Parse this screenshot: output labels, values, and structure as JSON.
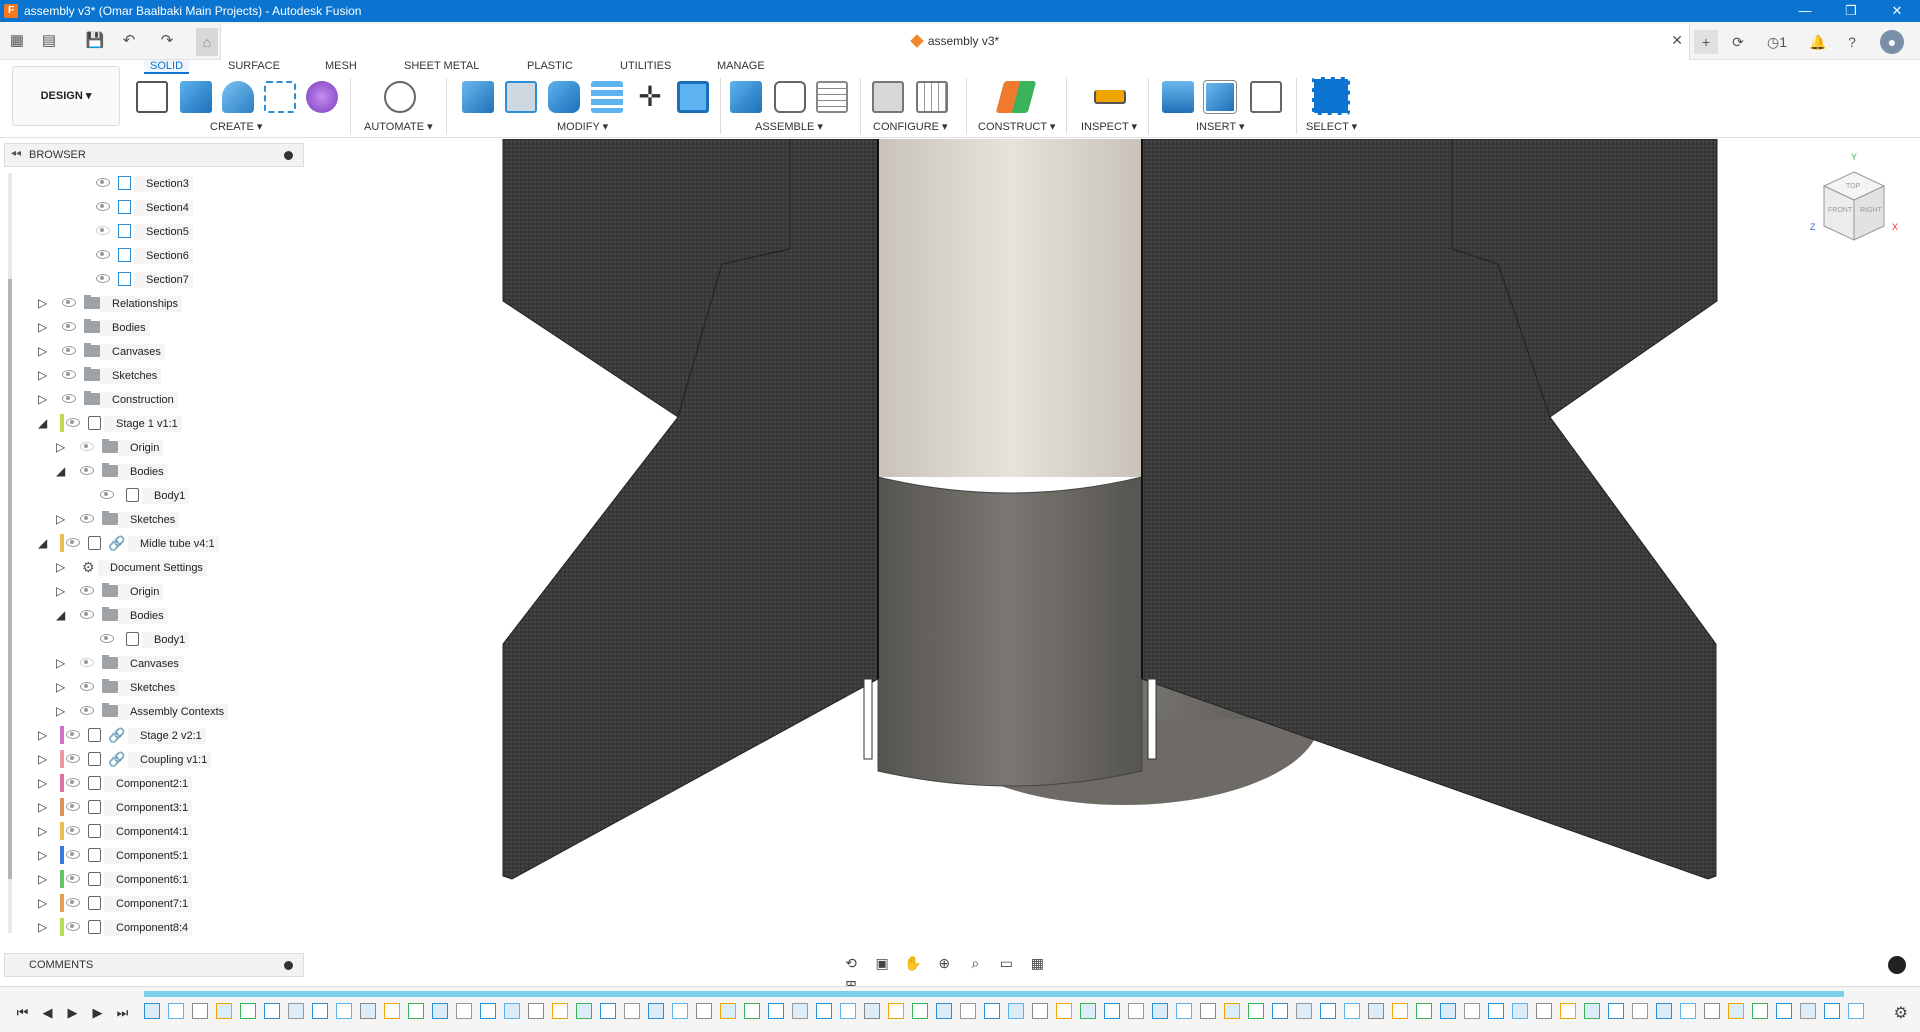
{
  "window": {
    "title": "assembly v3* (Omar Baalbaki Main Projects) - Autodesk Fusion",
    "controls": [
      "—",
      "❐",
      "✕"
    ]
  },
  "document": {
    "tab_title": "assembly v3*",
    "notification_count": "1"
  },
  "ribbon": {
    "workspace_label": "DESIGN ▾",
    "tabs": [
      "SOLID",
      "SURFACE",
      "MESH",
      "SHEET METAL",
      "PLASTIC",
      "UTILITIES",
      "MANAGE"
    ],
    "active_tab": "SOLID",
    "groups": {
      "create": "CREATE ▾",
      "automate": "AUTOMATE ▾",
      "modify": "MODIFY ▾",
      "assemble": "ASSEMBLE ▾",
      "configure": "CONFIGURE ▾",
      "construct": "CONSTRUCT ▾",
      "inspect": "INSPECT ▾",
      "insert": "INSERT ▾",
      "select": "SELECT ▾"
    }
  },
  "browser": {
    "title": "BROWSER",
    "items": [
      {
        "label": "Section3",
        "type": "sketch",
        "expander": ""
      },
      {
        "label": "Section4",
        "type": "sketch",
        "expander": ""
      },
      {
        "label": "Section5",
        "type": "sketch",
        "expander": ""
      },
      {
        "label": "Section6",
        "type": "sketch",
        "expander": ""
      },
      {
        "label": "Section7",
        "type": "sketch",
        "expander": ""
      },
      {
        "label": "Relationships",
        "type": "folder",
        "expander": "▷"
      },
      {
        "label": "Bodies",
        "type": "folder",
        "expander": "▷"
      },
      {
        "label": "Canvases",
        "type": "folder",
        "expander": "▷"
      },
      {
        "label": "Sketches",
        "type": "folder",
        "expander": "▷"
      },
      {
        "label": "Construction",
        "type": "folder",
        "expander": "▷"
      },
      {
        "label": "Stage 1 v1:1",
        "type": "component",
        "expander": "◢"
      },
      {
        "label": "Origin",
        "type": "folder",
        "expander": "▷"
      },
      {
        "label": "Bodies",
        "type": "folder",
        "expander": "◢"
      },
      {
        "label": "Body1",
        "type": "body",
        "expander": ""
      },
      {
        "label": "Sketches",
        "type": "folder",
        "expander": "▷"
      },
      {
        "label": "Midle tube v4:1",
        "type": "linked",
        "expander": "◢"
      },
      {
        "label": "Document Settings",
        "type": "settings",
        "expander": "▷"
      },
      {
        "label": "Origin",
        "type": "folder",
        "expander": "▷"
      },
      {
        "label": "Bodies",
        "type": "folder",
        "expander": "◢"
      },
      {
        "label": "Body1",
        "type": "body",
        "expander": ""
      },
      {
        "label": "Canvases",
        "type": "folder",
        "expander": "▷"
      },
      {
        "label": "Sketches",
        "type": "folder",
        "expander": "▷"
      },
      {
        "label": "Assembly Contexts",
        "type": "folder",
        "expander": "▷"
      },
      {
        "label": "Stage 2 v2:1",
        "type": "linked",
        "expander": "▷"
      },
      {
        "label": "Coupling v1:1",
        "type": "linked",
        "expander": "▷"
      },
      {
        "label": "Component2:1",
        "type": "component",
        "expander": "▷"
      },
      {
        "label": "Component3:1",
        "type": "component",
        "expander": "▷"
      },
      {
        "label": "Component4:1",
        "type": "component",
        "expander": "▷"
      },
      {
        "label": "Component5:1",
        "type": "component",
        "expander": "▷"
      },
      {
        "label": "Component6:1",
        "type": "component",
        "expander": "▷"
      },
      {
        "label": "Component7:1",
        "type": "component",
        "expander": "▷"
      },
      {
        "label": "Component8:4",
        "type": "component",
        "expander": "▷"
      }
    ]
  },
  "comments": {
    "title": "COMMENTS"
  },
  "viewcube": {
    "top": "TOP",
    "front": "FRONT",
    "right": "RIGHT",
    "y": "Y",
    "x": "X",
    "z": "Z"
  },
  "colors": {
    "accent": "#0a74d0",
    "fin": "#3a3a3a",
    "tube_upper": "#ddd8d2",
    "tube_lower": "#6e6b67",
    "timeline": "#79d0e8"
  }
}
